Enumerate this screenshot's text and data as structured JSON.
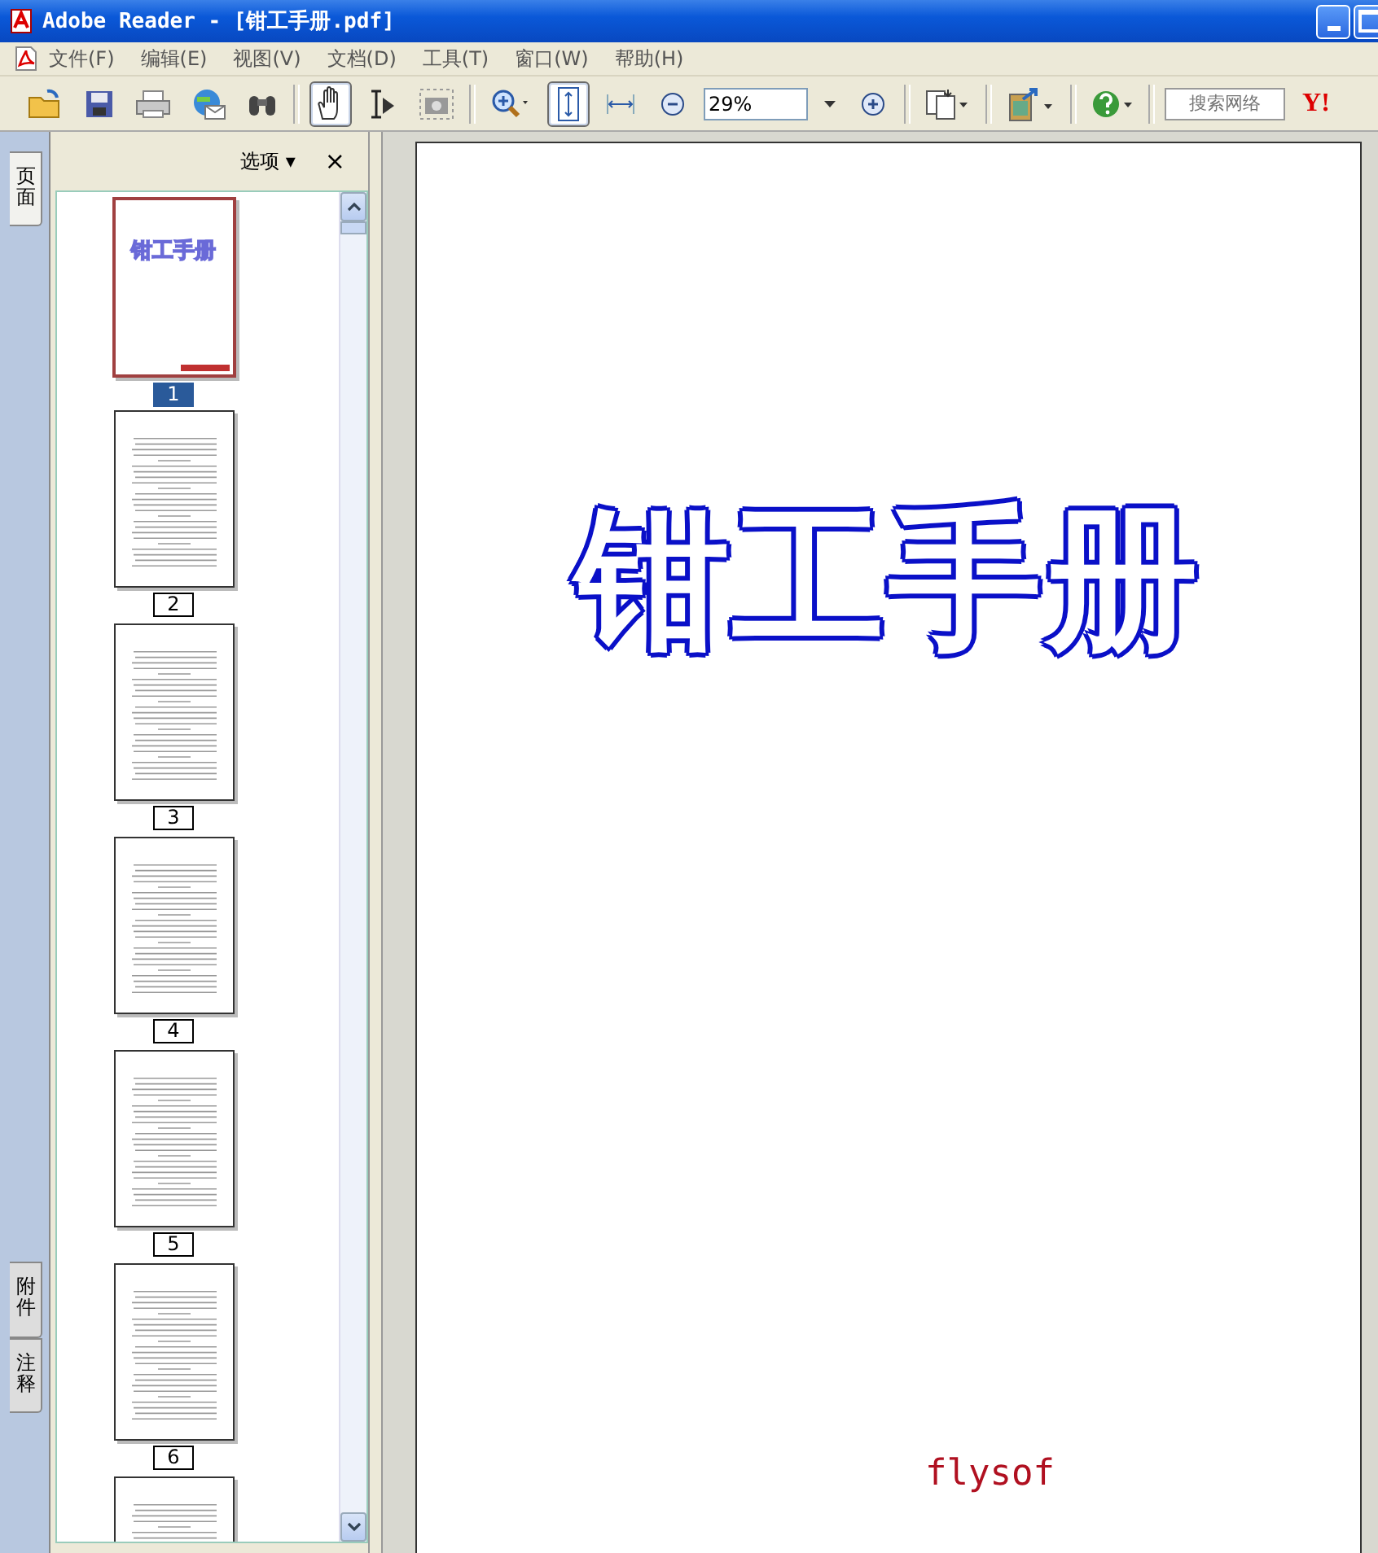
{
  "window": {
    "title": "Adobe Reader - [钳工手册.pdf]"
  },
  "menu": [
    "文件(F)",
    "编辑(E)",
    "视图(V)",
    "文档(D)",
    "工具(T)",
    "窗口(W)",
    "帮助(H)"
  ],
  "toolbar": {
    "groups": [
      [
        {
          "kind": "open",
          "selected": false
        },
        {
          "kind": "save",
          "selected": false
        },
        {
          "kind": "print",
          "selected": false
        },
        {
          "kind": "email",
          "selected": false
        },
        {
          "kind": "find",
          "selected": false
        }
      ],
      [
        {
          "kind": "hand",
          "selected": true
        },
        {
          "kind": "select",
          "selected": false
        },
        {
          "kind": "snapshot",
          "selected": false
        }
      ],
      [
        {
          "kind": "zoomin",
          "selected": false
        },
        {
          "kind": "fitpage",
          "selected": true
        },
        {
          "kind": "fitwidth",
          "selected": false
        },
        {
          "kind": "minus",
          "selected": false
        },
        {
          "kind": "zoom"
        },
        {
          "kind": "plus",
          "selected": false
        }
      ],
      [
        {
          "kind": "pages",
          "selected": false
        }
      ],
      [
        {
          "kind": "export",
          "selected": false
        }
      ],
      [
        {
          "kind": "help",
          "selected": false
        }
      ],
      [
        {
          "kind": "search"
        },
        {
          "kind": "yahoo"
        }
      ]
    ],
    "zoom": "29%",
    "search_placeholder": "搜索网络",
    "yahoo": "Y!"
  },
  "side_tabs": [
    {
      "label": "页面",
      "selected": true
    },
    {
      "label": "附件",
      "selected": false
    },
    {
      "label": "注释",
      "selected": false
    }
  ],
  "panel": {
    "options": "选项 ▾",
    "close": "×",
    "thumbnails": [
      {
        "label": "1",
        "selected": true,
        "kind": "cover",
        "title": "钳工手册"
      },
      {
        "label": "2",
        "selected": false,
        "kind": "toc"
      },
      {
        "label": "3",
        "selected": false,
        "kind": "toc"
      },
      {
        "label": "4",
        "selected": false,
        "kind": "toc"
      },
      {
        "label": "5",
        "selected": false,
        "kind": "toc"
      },
      {
        "label": "6",
        "selected": false,
        "kind": "toc"
      },
      {
        "selected": false,
        "kind": "toc"
      }
    ]
  },
  "document": {
    "title": "钳工手册",
    "footer": "flysof"
  }
}
